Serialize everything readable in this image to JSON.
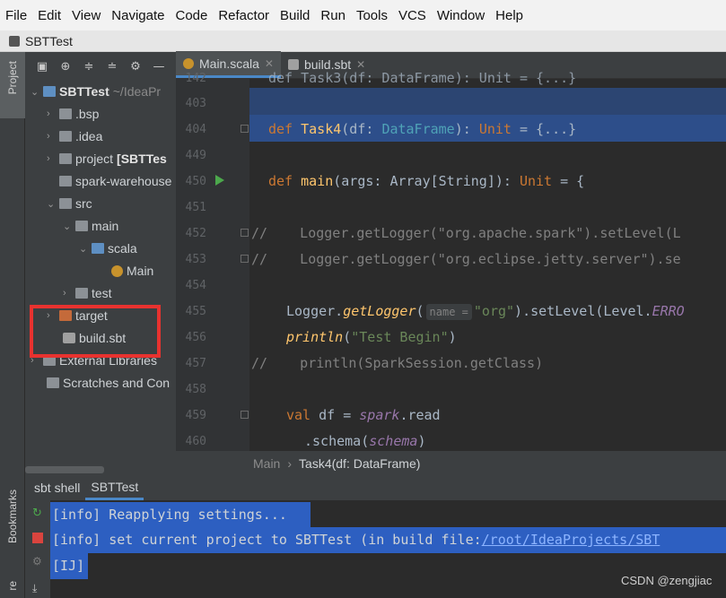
{
  "menu": [
    "File",
    "Edit",
    "View",
    "Navigate",
    "Code",
    "Refactor",
    "Build",
    "Run",
    "Tools",
    "VCS",
    "Window",
    "Help"
  ],
  "title": "SBTTest",
  "stripe": {
    "project_label": "Project",
    "bookmarks_label": "Bookmarks",
    "structure_label": "re"
  },
  "tree": {
    "root_name": "SBTTest",
    "root_path": "~/IdeaPr",
    "items": [
      {
        "label": ".bsp"
      },
      {
        "label": ".idea"
      },
      {
        "label": "project",
        "suffix": "[SBTTes"
      },
      {
        "label": "spark-warehouse"
      },
      {
        "label": "src"
      },
      {
        "label": "main"
      },
      {
        "label": "scala"
      },
      {
        "label": "Main"
      },
      {
        "label": "test"
      },
      {
        "label": "target"
      },
      {
        "label": "build.sbt"
      },
      {
        "label": "External Libraries"
      },
      {
        "label": "Scratches and Con"
      }
    ]
  },
  "tabs": [
    {
      "label": "Main.scala",
      "active": true
    },
    {
      "label": "build.sbt",
      "active": false
    }
  ],
  "editor": {
    "line_numbers": [
      "142",
      "403",
      "404",
      "449",
      "450",
      "451",
      "452",
      "453",
      "454",
      "455",
      "456",
      "457",
      "458",
      "459",
      "460"
    ],
    "line_142": "def Task3(df: DataFrame): Unit = {...}",
    "line_404": {
      "kw": "def ",
      "fn": "Task4",
      "p1": "(df: ",
      "ty": "DataFrame",
      "p2": "): ",
      "unit": "Unit",
      "p3": " = {...}"
    },
    "line_450": {
      "kw": "def ",
      "fn": "main",
      "p1": "(args: Array[String]): ",
      "unit": "Unit",
      "p2": " = {"
    },
    "line_452": "//    Logger.getLogger(\"org.apache.spark\").setLevel(L",
    "line_453": "//    Logger.getLogger(\"org.eclipse.jetty.server\").se",
    "line_455": {
      "a": "Logger.",
      "fn": "getLogger",
      "b": "(",
      "hint": "name =",
      "str": "\"org\"",
      "c": ").setLevel(Level.",
      "it": "ERRO"
    },
    "line_456": {
      "fn": "println",
      "a": "(",
      "str": "\"Test Begin\"",
      "b": ")"
    },
    "line_457": "//    println(SparkSession.getClass)",
    "line_459": {
      "kw": "val ",
      "a": "df = ",
      "it": "spark",
      "b": ".read"
    },
    "line_460": {
      "a": ".schema(",
      "it": "schema",
      "b": ")"
    }
  },
  "breadcrumb": {
    "file": "Main",
    "sep": "›",
    "current": "Task4(df: DataFrame)"
  },
  "bottom": {
    "tabs": [
      "sbt shell",
      "SBTTest"
    ],
    "lines": [
      "[info] Reapplying settings...",
      "[info] set current project to SBTTest (in build file:",
      "[IJ]"
    ],
    "link": "/root/IdeaProjects/SBT"
  },
  "watermark": "CSDN @zengjiac"
}
